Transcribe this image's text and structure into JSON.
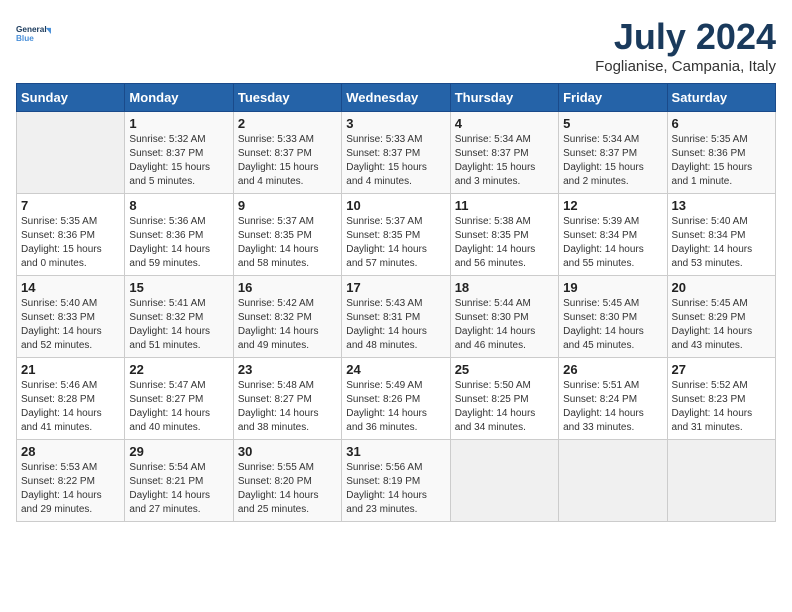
{
  "header": {
    "logo_line1": "General",
    "logo_line2": "Blue",
    "month_year": "July 2024",
    "location": "Foglianise, Campania, Italy"
  },
  "weekdays": [
    "Sunday",
    "Monday",
    "Tuesday",
    "Wednesday",
    "Thursday",
    "Friday",
    "Saturday"
  ],
  "weeks": [
    [
      {
        "day": "",
        "info": ""
      },
      {
        "day": "1",
        "info": "Sunrise: 5:32 AM\nSunset: 8:37 PM\nDaylight: 15 hours\nand 5 minutes."
      },
      {
        "day": "2",
        "info": "Sunrise: 5:33 AM\nSunset: 8:37 PM\nDaylight: 15 hours\nand 4 minutes."
      },
      {
        "day": "3",
        "info": "Sunrise: 5:33 AM\nSunset: 8:37 PM\nDaylight: 15 hours\nand 4 minutes."
      },
      {
        "day": "4",
        "info": "Sunrise: 5:34 AM\nSunset: 8:37 PM\nDaylight: 15 hours\nand 3 minutes."
      },
      {
        "day": "5",
        "info": "Sunrise: 5:34 AM\nSunset: 8:37 PM\nDaylight: 15 hours\nand 2 minutes."
      },
      {
        "day": "6",
        "info": "Sunrise: 5:35 AM\nSunset: 8:36 PM\nDaylight: 15 hours\nand 1 minute."
      }
    ],
    [
      {
        "day": "7",
        "info": "Sunrise: 5:35 AM\nSunset: 8:36 PM\nDaylight: 15 hours\nand 0 minutes."
      },
      {
        "day": "8",
        "info": "Sunrise: 5:36 AM\nSunset: 8:36 PM\nDaylight: 14 hours\nand 59 minutes."
      },
      {
        "day": "9",
        "info": "Sunrise: 5:37 AM\nSunset: 8:35 PM\nDaylight: 14 hours\nand 58 minutes."
      },
      {
        "day": "10",
        "info": "Sunrise: 5:37 AM\nSunset: 8:35 PM\nDaylight: 14 hours\nand 57 minutes."
      },
      {
        "day": "11",
        "info": "Sunrise: 5:38 AM\nSunset: 8:35 PM\nDaylight: 14 hours\nand 56 minutes."
      },
      {
        "day": "12",
        "info": "Sunrise: 5:39 AM\nSunset: 8:34 PM\nDaylight: 14 hours\nand 55 minutes."
      },
      {
        "day": "13",
        "info": "Sunrise: 5:40 AM\nSunset: 8:34 PM\nDaylight: 14 hours\nand 53 minutes."
      }
    ],
    [
      {
        "day": "14",
        "info": "Sunrise: 5:40 AM\nSunset: 8:33 PM\nDaylight: 14 hours\nand 52 minutes."
      },
      {
        "day": "15",
        "info": "Sunrise: 5:41 AM\nSunset: 8:32 PM\nDaylight: 14 hours\nand 51 minutes."
      },
      {
        "day": "16",
        "info": "Sunrise: 5:42 AM\nSunset: 8:32 PM\nDaylight: 14 hours\nand 49 minutes."
      },
      {
        "day": "17",
        "info": "Sunrise: 5:43 AM\nSunset: 8:31 PM\nDaylight: 14 hours\nand 48 minutes."
      },
      {
        "day": "18",
        "info": "Sunrise: 5:44 AM\nSunset: 8:30 PM\nDaylight: 14 hours\nand 46 minutes."
      },
      {
        "day": "19",
        "info": "Sunrise: 5:45 AM\nSunset: 8:30 PM\nDaylight: 14 hours\nand 45 minutes."
      },
      {
        "day": "20",
        "info": "Sunrise: 5:45 AM\nSunset: 8:29 PM\nDaylight: 14 hours\nand 43 minutes."
      }
    ],
    [
      {
        "day": "21",
        "info": "Sunrise: 5:46 AM\nSunset: 8:28 PM\nDaylight: 14 hours\nand 41 minutes."
      },
      {
        "day": "22",
        "info": "Sunrise: 5:47 AM\nSunset: 8:27 PM\nDaylight: 14 hours\nand 40 minutes."
      },
      {
        "day": "23",
        "info": "Sunrise: 5:48 AM\nSunset: 8:27 PM\nDaylight: 14 hours\nand 38 minutes."
      },
      {
        "day": "24",
        "info": "Sunrise: 5:49 AM\nSunset: 8:26 PM\nDaylight: 14 hours\nand 36 minutes."
      },
      {
        "day": "25",
        "info": "Sunrise: 5:50 AM\nSunset: 8:25 PM\nDaylight: 14 hours\nand 34 minutes."
      },
      {
        "day": "26",
        "info": "Sunrise: 5:51 AM\nSunset: 8:24 PM\nDaylight: 14 hours\nand 33 minutes."
      },
      {
        "day": "27",
        "info": "Sunrise: 5:52 AM\nSunset: 8:23 PM\nDaylight: 14 hours\nand 31 minutes."
      }
    ],
    [
      {
        "day": "28",
        "info": "Sunrise: 5:53 AM\nSunset: 8:22 PM\nDaylight: 14 hours\nand 29 minutes."
      },
      {
        "day": "29",
        "info": "Sunrise: 5:54 AM\nSunset: 8:21 PM\nDaylight: 14 hours\nand 27 minutes."
      },
      {
        "day": "30",
        "info": "Sunrise: 5:55 AM\nSunset: 8:20 PM\nDaylight: 14 hours\nand 25 minutes."
      },
      {
        "day": "31",
        "info": "Sunrise: 5:56 AM\nSunset: 8:19 PM\nDaylight: 14 hours\nand 23 minutes."
      },
      {
        "day": "",
        "info": ""
      },
      {
        "day": "",
        "info": ""
      },
      {
        "day": "",
        "info": ""
      }
    ]
  ]
}
